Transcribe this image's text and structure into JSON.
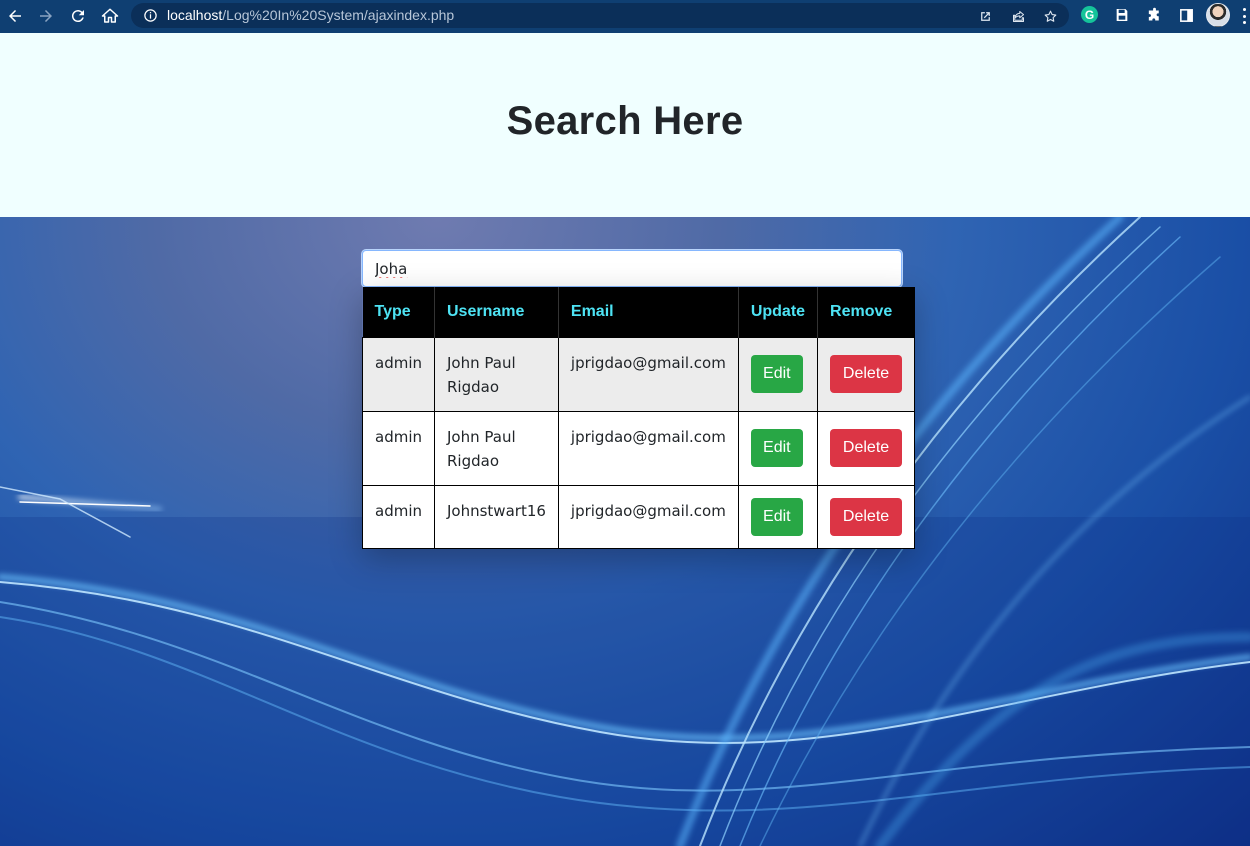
{
  "browser": {
    "url_host": "localhost",
    "url_path": "/Log%20In%20System/ajaxindex.php",
    "icons": {
      "back": "arrow-left-icon",
      "forward": "arrow-right-icon",
      "reload": "reload-icon",
      "home": "home-icon",
      "site_info": "info-icon",
      "open_in": "open-external-icon",
      "share": "share-icon",
      "bookmark": "star-icon",
      "grammarly": "grammarly-icon",
      "save": "save-icon",
      "extensions": "puzzle-icon",
      "sidepanel": "sidepanel-icon",
      "profile": "avatar",
      "menu": "kebab-menu-icon"
    },
    "grammarly_letter": "G"
  },
  "header": {
    "title": "Search Here"
  },
  "search": {
    "value": "Joha"
  },
  "table": {
    "headers": [
      "Type",
      "Username",
      "Email",
      "Update",
      "Remove"
    ],
    "rows": [
      {
        "type": "admin",
        "username": "John Paul Rigdao",
        "email": "jprigdao@gmail.com",
        "edit": "Edit",
        "delete": "Delete"
      },
      {
        "type": "admin",
        "username": "John Paul Rigdao",
        "email": "jprigdao@gmail.com",
        "edit": "Edit",
        "delete": "Delete"
      },
      {
        "type": "admin",
        "username": "Johnstwart16",
        "email": "jprigdao@gmail.com",
        "edit": "Edit",
        "delete": "Delete"
      }
    ]
  },
  "colors": {
    "toolbar": "#0f3f72",
    "header_bg": "#f0ffff",
    "table_header_bg": "#000000",
    "table_header_text": "#4ee3f4",
    "edit_button": "#28a745",
    "delete_button": "#dc3545"
  }
}
